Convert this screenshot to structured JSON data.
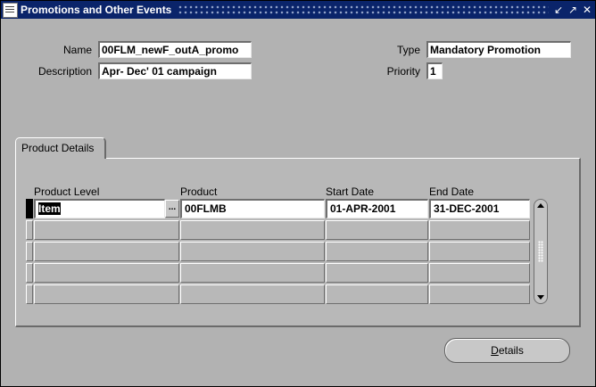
{
  "window": {
    "title": "Promotions and Other Events",
    "controls": [
      "minimize-icon",
      "maximize-icon",
      "close-icon"
    ]
  },
  "header": {
    "name_label": "Name",
    "name_value": "00FLM_newF_outA_promo",
    "description_label": "Description",
    "description_value": "Apr- Dec' 01 campaign",
    "type_label": "Type",
    "type_value": "Mandatory Promotion",
    "priority_label": "Priority",
    "priority_value": "1"
  },
  "tabs": [
    {
      "label": "Product Details",
      "active": true
    }
  ],
  "grid": {
    "columns": [
      "Product Level",
      "Product",
      "Start Date",
      "End Date"
    ],
    "rows": [
      {
        "product_level": "Item",
        "product": "00FLMB",
        "start_date": "01-APR-2001",
        "end_date": "31-DEC-2001"
      },
      {
        "product_level": "",
        "product": "",
        "start_date": "",
        "end_date": ""
      },
      {
        "product_level": "",
        "product": "",
        "start_date": "",
        "end_date": ""
      },
      {
        "product_level": "",
        "product": "",
        "start_date": "",
        "end_date": ""
      },
      {
        "product_level": "",
        "product": "",
        "start_date": "",
        "end_date": ""
      }
    ],
    "lov_button": "..."
  },
  "buttons": {
    "details_mnemonic": "D",
    "details_rest": "etails"
  },
  "colors": {
    "titlebar": "#0a246a",
    "canvas": "#b2b2b2",
    "panel": "#b8b8b8",
    "field": "#ffffff"
  }
}
